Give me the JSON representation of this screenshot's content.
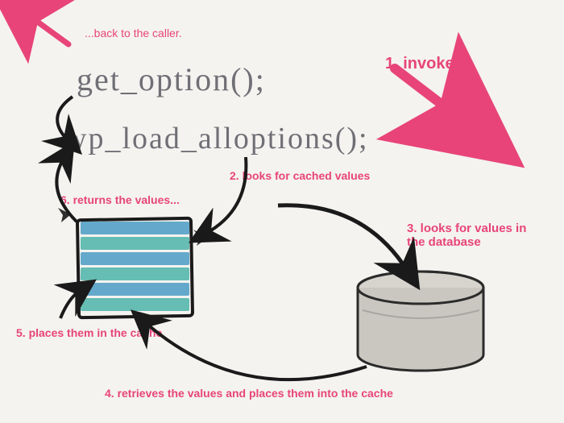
{
  "code": {
    "fn1": "get_option();",
    "fn2": "wp_load_alloptions();"
  },
  "steps": {
    "s1": "1. invokes",
    "s2": "2. looks for cached values",
    "s3": "3. looks for values in the database",
    "s4": "4. retrieves the values and places them into the cache",
    "s5": "5. places them in the cache",
    "s6": "6. returns the values...",
    "back": "...back to the caller."
  },
  "colors": {
    "pink": "#e8447a",
    "ink": "#2b2b2b",
    "teal": "#4bb3a8",
    "blue": "#4a9bc4",
    "grey": "#b8b6b0"
  }
}
